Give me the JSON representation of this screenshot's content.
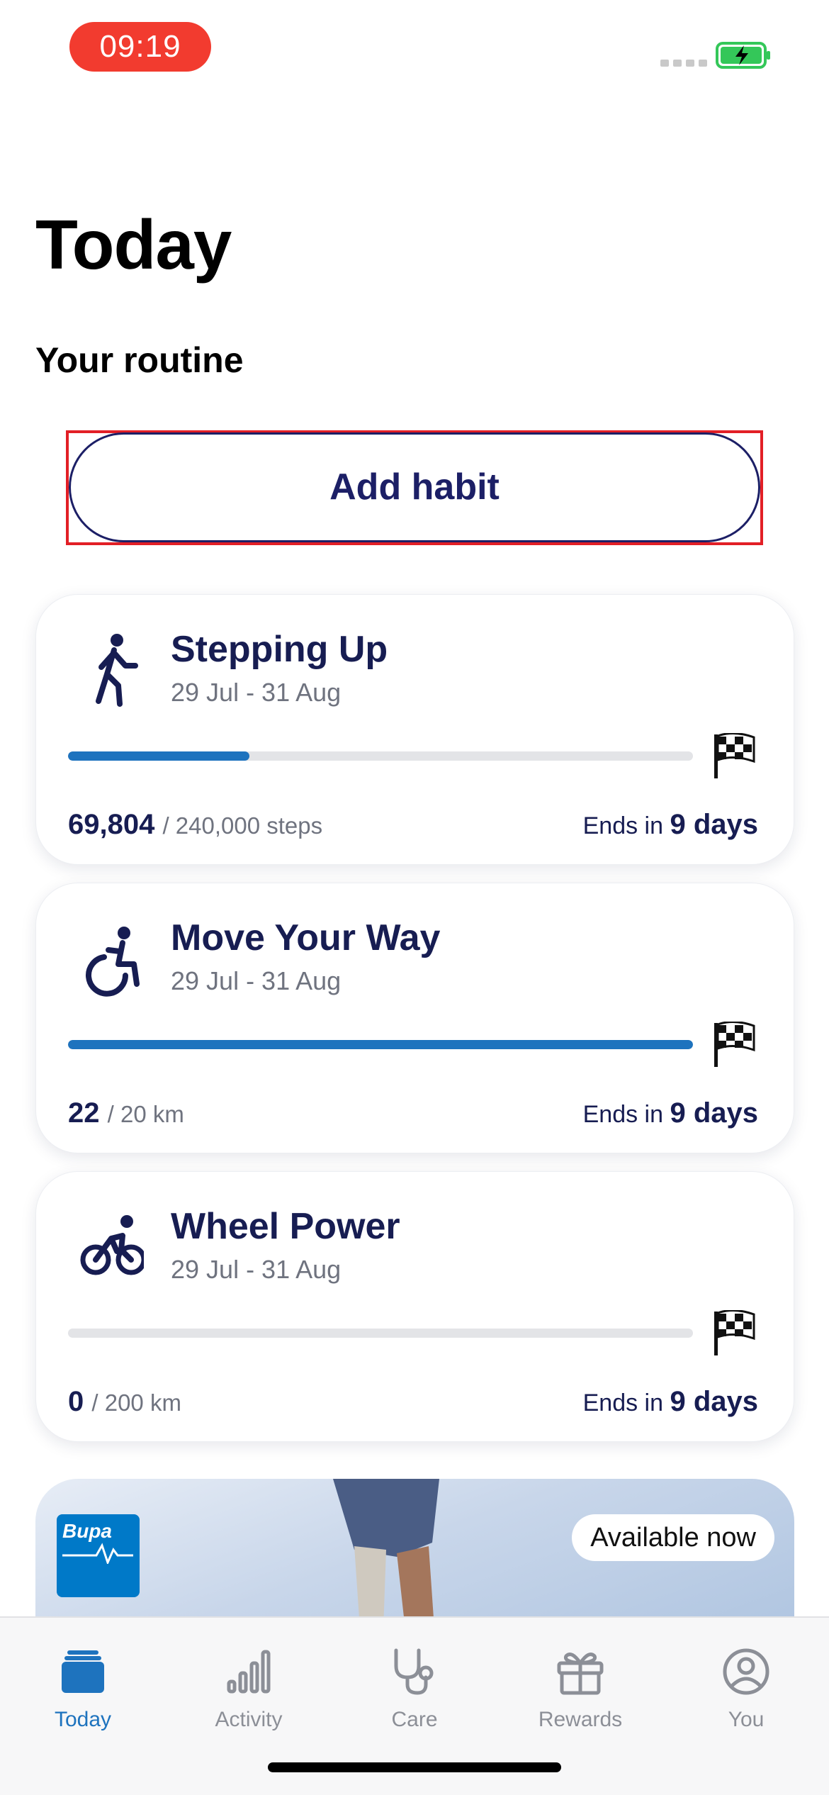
{
  "status_bar": {
    "time": "09:19"
  },
  "page": {
    "title": "Today",
    "section": "Your routine"
  },
  "add_habit": {
    "label": "Add habit"
  },
  "habits": [
    {
      "icon": "walking-person-icon",
      "title": "Stepping Up",
      "dates": "29 Jul - 31 Aug",
      "current": "69,804",
      "target": "/ 240,000 steps",
      "progress": 0.29,
      "ends_prefix": "Ends in",
      "ends_value": "9 days"
    },
    {
      "icon": "wheelchair-icon",
      "title": "Move Your Way",
      "dates": "29 Jul - 31 Aug",
      "current": "22",
      "target": "/ 20 km",
      "progress": 1.0,
      "ends_prefix": "Ends in",
      "ends_value": "9 days"
    },
    {
      "icon": "cyclist-icon",
      "title": "Wheel Power",
      "dates": "29 Jul - 31 Aug",
      "current": "0",
      "target": "/ 200 km",
      "progress": 0.0,
      "ends_prefix": "Ends in",
      "ends_value": "9 days"
    }
  ],
  "promo": {
    "logo": "Bupa",
    "badge": "Available now"
  },
  "tabbar": [
    {
      "label": "Today",
      "icon": "today-stack-icon",
      "active": true
    },
    {
      "label": "Activity",
      "icon": "bar-chart-icon",
      "active": false
    },
    {
      "label": "Care",
      "icon": "stethoscope-icon",
      "active": false
    },
    {
      "label": "Rewards",
      "icon": "gift-icon",
      "active": false
    },
    {
      "label": "You",
      "icon": "profile-icon",
      "active": false
    }
  ],
  "colors": {
    "accent": "#1e73be",
    "navy": "#171d52",
    "status_red": "#f23b2f"
  }
}
